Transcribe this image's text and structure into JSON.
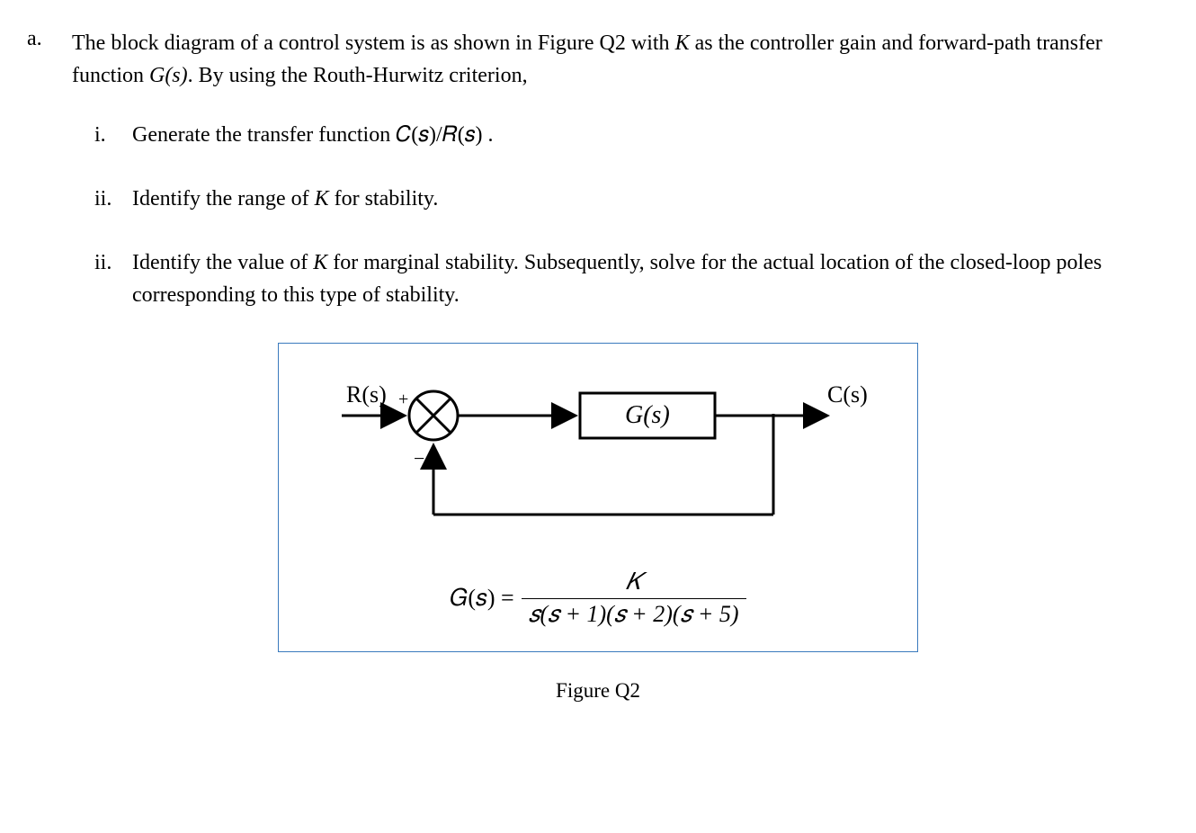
{
  "question": {
    "marker": "a.",
    "text_1": "The block diagram of a control system is as shown in Figure Q2 with ",
    "K": "K",
    "text_2": " as the controller gain and forward-path transfer function ",
    "Gs": "G(s)",
    "text_3": ". By using the Routh-Hurwitz criterion,"
  },
  "subs": [
    {
      "marker": "i.",
      "text": "Generate the transfer function 𝐶(𝑠)/𝑅(𝑠) ."
    },
    {
      "marker": "ii.",
      "text_1": "Identify the range of ",
      "K": "K",
      "text_2": " for stability."
    },
    {
      "marker": "ii.",
      "text_1": "Identify the value of ",
      "K": "K",
      "text_2": " for marginal stability. Subsequently, solve for the actual location of the closed-loop poles corresponding to this type of stability."
    }
  ],
  "diagram": {
    "input_label": "R(s)",
    "output_label": "C(s)",
    "block_label": "G(s)",
    "plus": "+",
    "minus": "−",
    "equation_lhs": "𝐺(𝑠) =",
    "equation_num": "𝐾",
    "equation_den": "𝑠(𝑠 + 1)(𝑠 + 2)(𝑠 + 5)",
    "caption": "Figure Q2"
  }
}
